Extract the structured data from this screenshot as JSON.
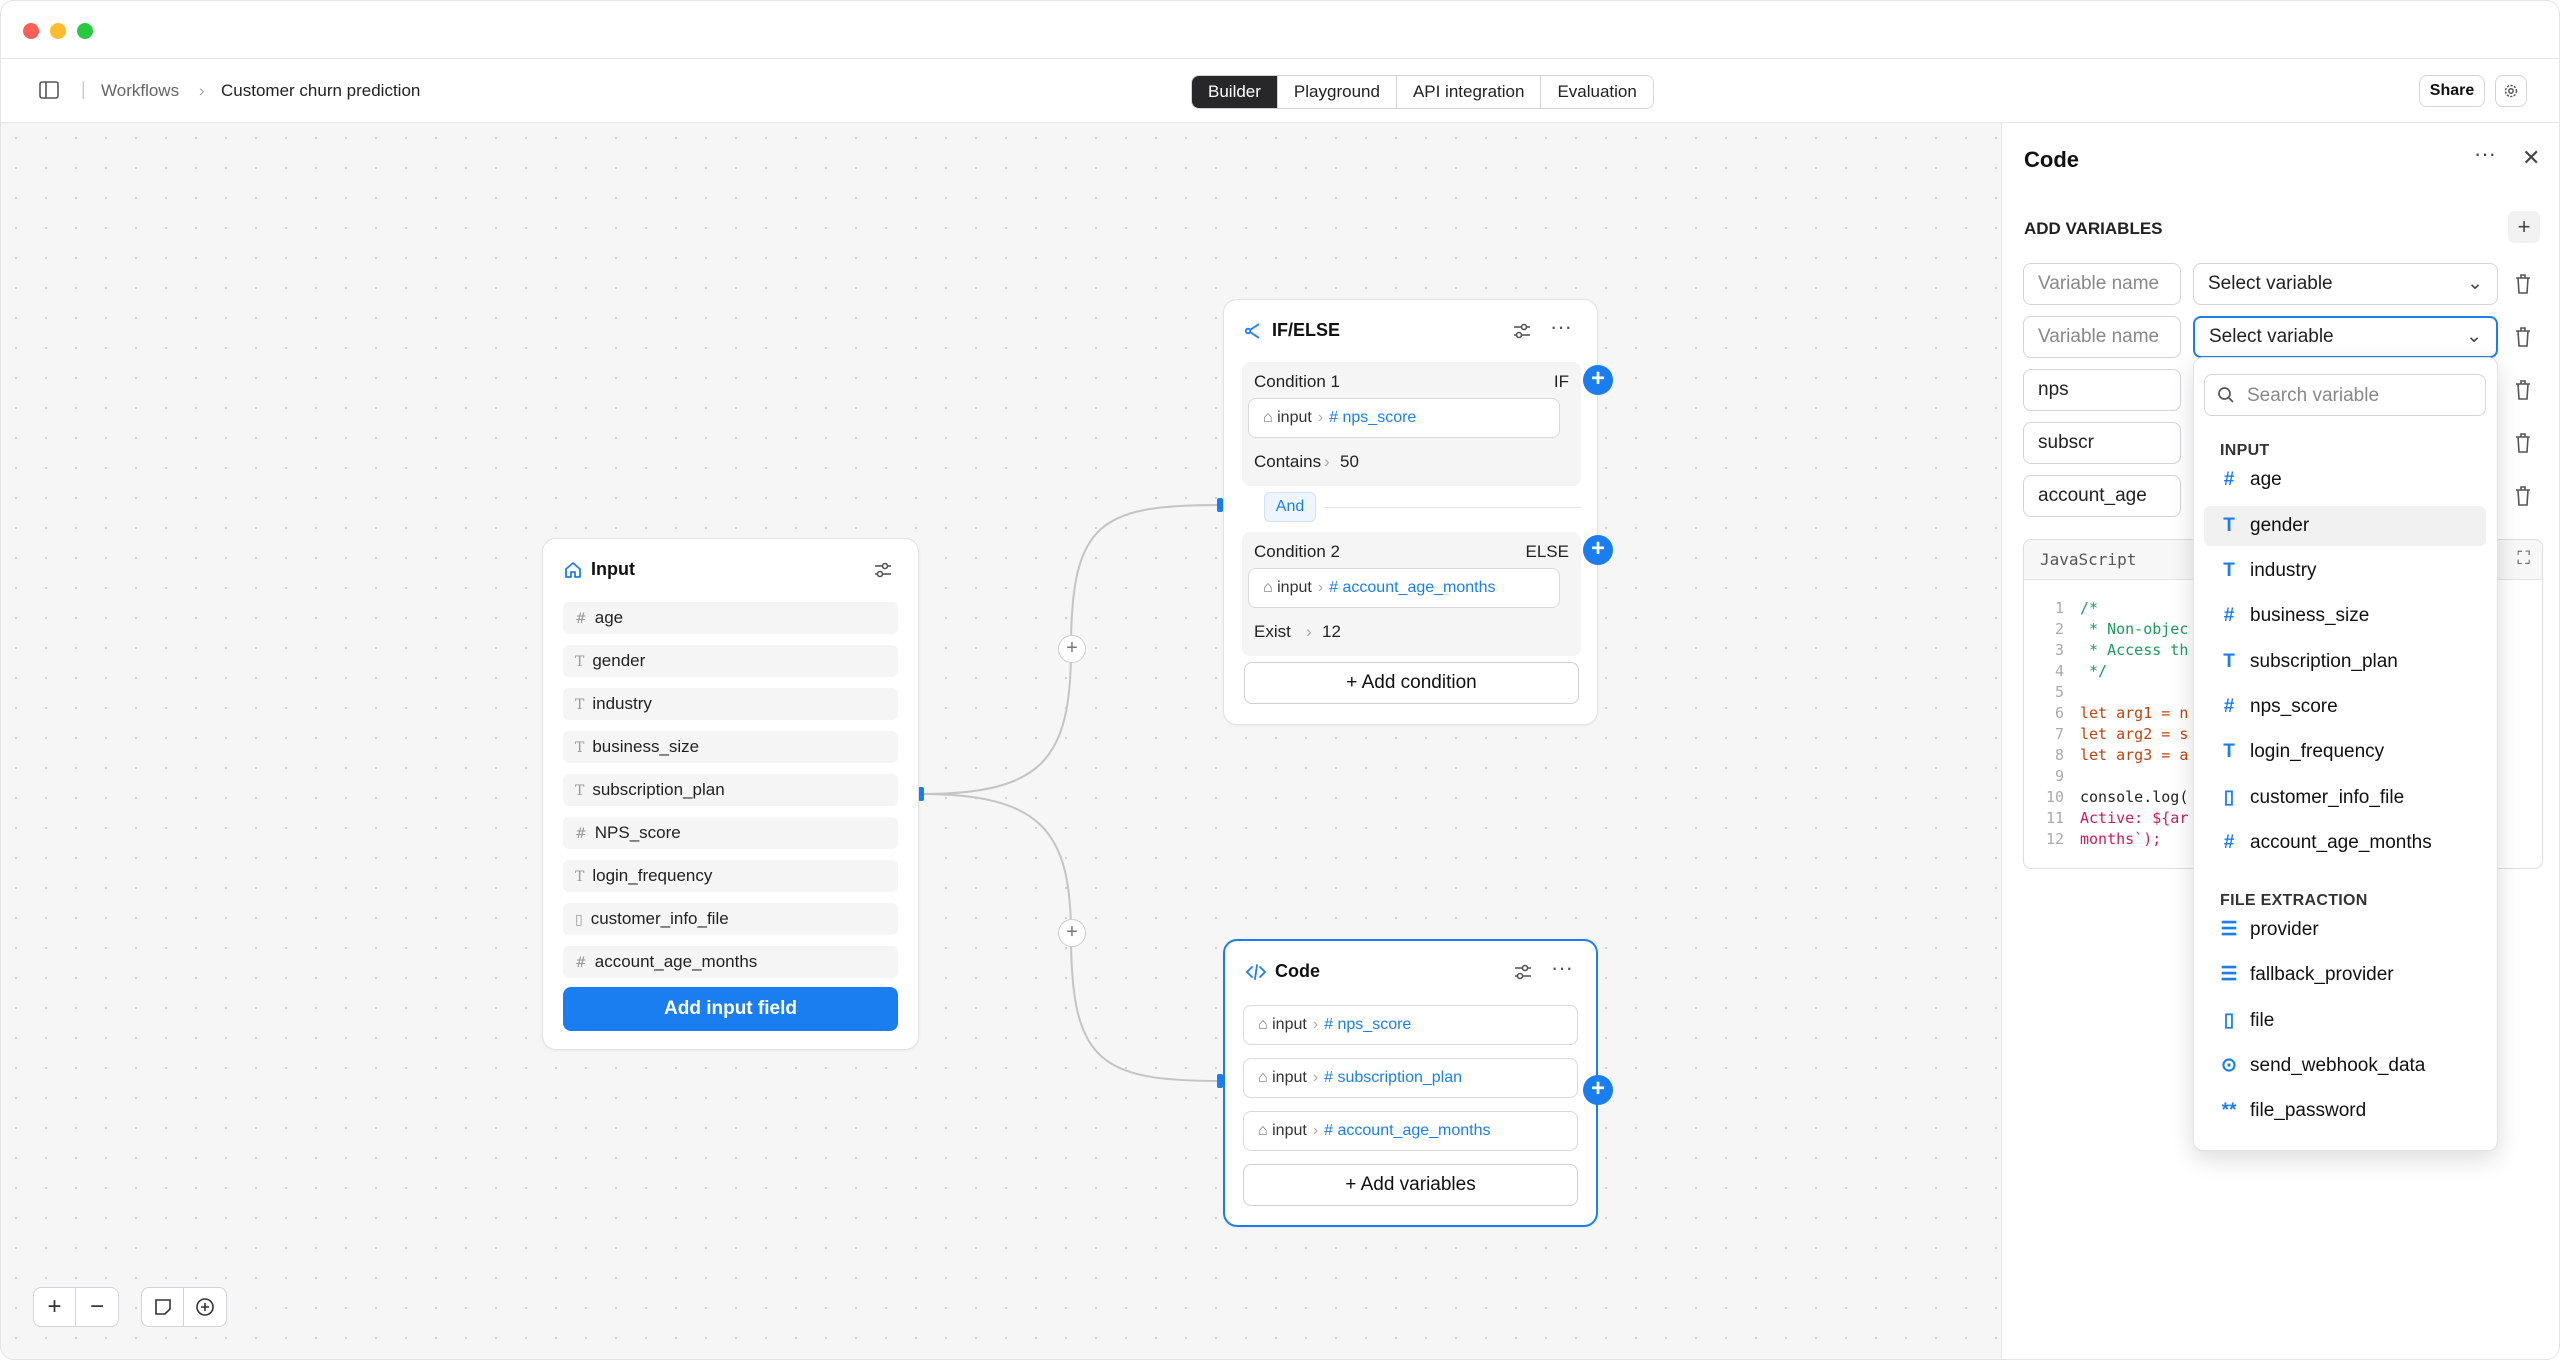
{
  "breadcrumb": {
    "root": "Workflows",
    "current": "Customer churn prediction"
  },
  "tabs": [
    {
      "label": "Builder",
      "active": true
    },
    {
      "label": "Playground",
      "active": false
    },
    {
      "label": "API integration",
      "active": false
    },
    {
      "label": "Evaluation",
      "active": false
    }
  ],
  "header": {
    "share_label": "Share"
  },
  "input_node": {
    "title": "Input",
    "fields": [
      {
        "name": "age",
        "type": "#"
      },
      {
        "name": "gender",
        "type": "T"
      },
      {
        "name": "industry",
        "type": "T"
      },
      {
        "name": "business_size",
        "type": "T"
      },
      {
        "name": "subscription_plan",
        "type": "T"
      },
      {
        "name": "NPS_score",
        "type": "#"
      },
      {
        "name": "login_frequency",
        "type": "T"
      },
      {
        "name": "customer_info_file",
        "type": "file"
      },
      {
        "name": "account_age_months",
        "type": "#"
      }
    ],
    "add_button": "Add input field"
  },
  "ifelse_node": {
    "title": "IF/ELSE",
    "cond1": {
      "label": "Condition 1",
      "branch": "IF",
      "source": "input",
      "var": "nps_score",
      "op": "Contains",
      "value": "50"
    },
    "connector": "And",
    "cond2": {
      "label": "Condition 2",
      "branch": "ELSE",
      "source": "input",
      "var": "account_age_months",
      "op": "Exist",
      "value": "12"
    },
    "add_button": "Add condition"
  },
  "code_node": {
    "title": "Code",
    "vars": [
      {
        "source": "input",
        "var": "nps_score"
      },
      {
        "source": "input",
        "var": "subscription_plan"
      },
      {
        "source": "input",
        "var": "account_age_months"
      }
    ],
    "add_button": "Add variables"
  },
  "panel": {
    "title": "Code",
    "section": "ADD VARIABLES",
    "rows": [
      {
        "name": "",
        "name_placeholder": "Variable name",
        "select": "Select variable"
      },
      {
        "name": "",
        "name_placeholder": "Variable name",
        "select": "Select variable"
      },
      {
        "name": "nps",
        "name_placeholder": "",
        "select": ""
      },
      {
        "name": "subscr",
        "name_placeholder": "",
        "select": ""
      },
      {
        "name": "account_age",
        "name_placeholder": "",
        "select": ""
      }
    ],
    "language": "JavaScript",
    "code_lines": [
      {
        "n": "1",
        "t": "/*"
      },
      {
        "n": "2",
        "t": " * Non-objec"
      },
      {
        "n": "3",
        "t": " * Access th"
      },
      {
        "n": "4",
        "t": " */"
      },
      {
        "n": "5",
        "t": ""
      },
      {
        "n": "6",
        "t": "let arg1 = n"
      },
      {
        "n": "7",
        "t": "let arg2 = s"
      },
      {
        "n": "8",
        "t": "let arg3 = a"
      },
      {
        "n": "9",
        "t": ""
      },
      {
        "n": "10",
        "t": "console.log("
      },
      {
        "n": "11",
        "t": "Active: ${ar"
      },
      {
        "n": "12",
        "t": "months`);"
      }
    ]
  },
  "dropdown": {
    "search_placeholder": "Search variable",
    "groups": [
      {
        "label": "INPUT",
        "items": [
          {
            "name": "age",
            "icon": "#"
          },
          {
            "name": "gender",
            "icon": "T",
            "highlighted": true
          },
          {
            "name": "industry",
            "icon": "T"
          },
          {
            "name": "business_size",
            "icon": "#"
          },
          {
            "name": "subscription_plan",
            "icon": "T"
          },
          {
            "name": "nps_score",
            "icon": "#"
          },
          {
            "name": "login_frequency",
            "icon": "T"
          },
          {
            "name": "customer_info_file",
            "icon": "file"
          },
          {
            "name": "account_age_months",
            "icon": "#"
          }
        ]
      },
      {
        "label": "FILE EXTRACTION",
        "items": [
          {
            "name": "provider",
            "icon": "db"
          },
          {
            "name": "fallback_provider",
            "icon": "db"
          },
          {
            "name": "file",
            "icon": "file"
          },
          {
            "name": "send_webhook_data",
            "icon": "toggle"
          },
          {
            "name": "file_password",
            "icon": "password"
          }
        ]
      }
    ]
  },
  "colors": {
    "accent": "#1b7ef0",
    "active_tab": "#27272a",
    "canvas": "#f6f6f6"
  }
}
